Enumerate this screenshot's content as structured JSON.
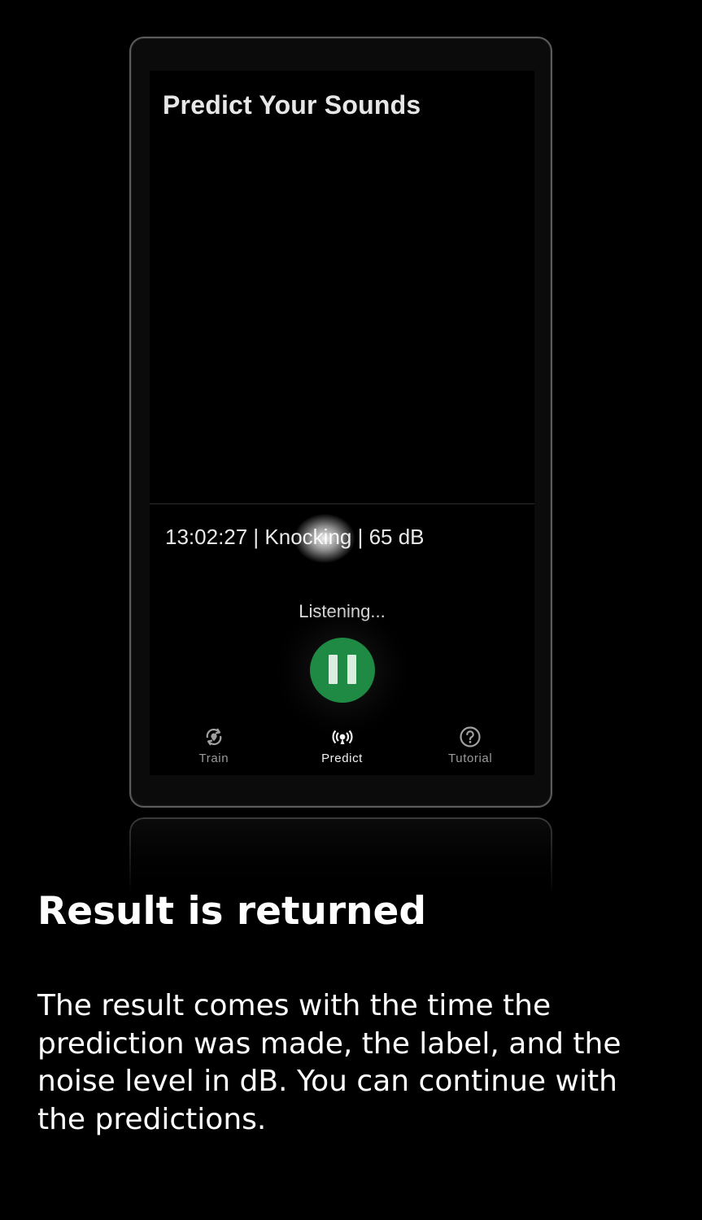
{
  "app": {
    "title": "Predict Your Sounds"
  },
  "result": {
    "line": "13:02:27 | Knocking | 65 dB"
  },
  "status": {
    "text": "Listening..."
  },
  "controls": {
    "pause_icon": "pause-icon",
    "accent_color": "#1e8a44"
  },
  "nav": {
    "items": [
      {
        "label": "Train",
        "icon": "train-icon",
        "active": false
      },
      {
        "label": "Predict",
        "icon": "broadcast-icon",
        "active": true
      },
      {
        "label": "Tutorial",
        "icon": "help-circle-icon",
        "active": false
      }
    ]
  },
  "caption": {
    "title": "Result is returned",
    "body": "The result comes with the time the prediction was made, the label, and the noise level in dB. You can continue with the predictions."
  }
}
